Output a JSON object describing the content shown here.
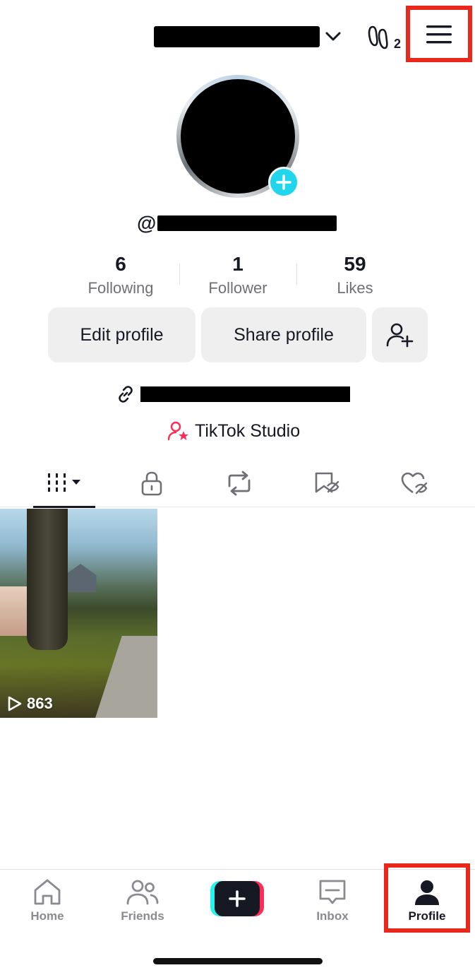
{
  "header": {
    "username_display": "(redacted)",
    "footprint_count": "2",
    "icons": [
      "chevron-down-icon",
      "footprints-icon",
      "hamburger-menu-icon"
    ]
  },
  "profile": {
    "handle_prefix": "@",
    "stats": [
      {
        "value": "6",
        "label": "Following"
      },
      {
        "value": "1",
        "label": "Follower"
      },
      {
        "value": "59",
        "label": "Likes"
      }
    ],
    "buttons": {
      "edit": "Edit profile",
      "share": "Share profile"
    },
    "studio_label": "TikTok Studio"
  },
  "tabs": [
    "videos-grid",
    "private",
    "reposts",
    "favorites",
    "liked"
  ],
  "videos": [
    {
      "views": "863"
    }
  ],
  "bottom_nav": {
    "home": "Home",
    "friends": "Friends",
    "inbox": "Inbox",
    "profile": "Profile"
  },
  "colors": {
    "highlight": "#e8281b",
    "accent_cyan": "#20d5ec",
    "accent_pink": "#fe2c55",
    "text_primary": "#161823",
    "text_secondary": "#6f7076",
    "button_bg": "#efefef"
  }
}
